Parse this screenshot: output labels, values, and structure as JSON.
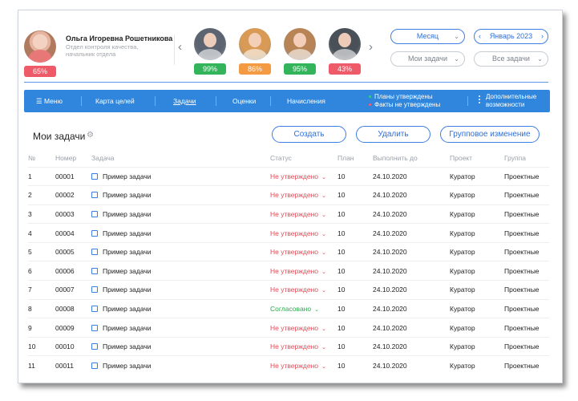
{
  "profile": {
    "name": "Ольга Игоревна Рошетникова",
    "role": "Отдел контроля качества, начальник отдела",
    "score": "65%",
    "score_color": "#ee5a67"
  },
  "colleagues": [
    {
      "score": "99%",
      "color": "#33b35a",
      "photo": "#5b6470"
    },
    {
      "score": "86%",
      "color": "#f39a43",
      "photo": "#d89a55"
    },
    {
      "score": "95%",
      "color": "#33b35a",
      "photo": "#b88456"
    },
    {
      "score": "43%",
      "color": "#ee5a67",
      "photo": "#4a5058"
    }
  ],
  "filters": {
    "period": "Месяц",
    "month": "Январь 2023",
    "my_tasks": "Мои задачи",
    "all_tasks": "Все задачи",
    "prev_icon": "chevron-left-icon",
    "next_icon": "chevron-right-icon"
  },
  "nav": {
    "menu": "Меню",
    "goals_map": "Карта целей",
    "tasks": "Задачи",
    "ratings": "Оценки",
    "accruals": "Начисления",
    "plans_approved": "Планы утверждены",
    "facts_not_approved": "Факты не утверждены",
    "additional_1": "Дополнительные",
    "additional_2": "возможности"
  },
  "tasks": {
    "title": "Мои задачи",
    "create": "Создать",
    "delete": "Удалить",
    "group_change": "Групповое изменение",
    "columns": [
      "№",
      "Номер",
      "Задача",
      "Статус",
      "План",
      "Выполнить до",
      "Проект",
      "Группа"
    ],
    "rows": [
      {
        "n": "1",
        "number": "00001",
        "task": "Пример задачи",
        "status": "Не утверждено",
        "ok": false,
        "plan": "10",
        "due": "24.10.2020",
        "project": "Куратор",
        "group": "Проектные"
      },
      {
        "n": "2",
        "number": "00002",
        "task": "Пример задачи",
        "status": "Не утверждено",
        "ok": false,
        "plan": "10",
        "due": "24.10.2020",
        "project": "Куратор",
        "group": "Проектные"
      },
      {
        "n": "3",
        "number": "00003",
        "task": "Пример задачи",
        "status": "Не утверждено",
        "ok": false,
        "plan": "10",
        "due": "24.10.2020",
        "project": "Куратор",
        "group": "Проектные"
      },
      {
        "n": "4",
        "number": "00004",
        "task": "Пример задачи",
        "status": "Не утверждено",
        "ok": false,
        "plan": "10",
        "due": "24.10.2020",
        "project": "Куратор",
        "group": "Проектные"
      },
      {
        "n": "5",
        "number": "00005",
        "task": "Пример задачи",
        "status": "Не утверждено",
        "ok": false,
        "plan": "10",
        "due": "24.10.2020",
        "project": "Куратор",
        "group": "Проектные"
      },
      {
        "n": "6",
        "number": "00006",
        "task": "Пример задачи",
        "status": "Не утверждено",
        "ok": false,
        "plan": "10",
        "due": "24.10.2020",
        "project": "Куратор",
        "group": "Проектные"
      },
      {
        "n": "7",
        "number": "00007",
        "task": "Пример задачи",
        "status": "Не утверждено",
        "ok": false,
        "plan": "10",
        "due": "24.10.2020",
        "project": "Куратор",
        "group": "Проектные"
      },
      {
        "n": "8",
        "number": "00008",
        "task": "Пример задачи",
        "status": "Согласовано",
        "ok": true,
        "plan": "10",
        "due": "24.10.2020",
        "project": "Куратор",
        "group": "Проектные"
      },
      {
        "n": "9",
        "number": "00009",
        "task": "Пример задачи",
        "status": "Не утверждено",
        "ok": false,
        "plan": "10",
        "due": "24.10.2020",
        "project": "Куратор",
        "group": "Проектные"
      },
      {
        "n": "10",
        "number": "00010",
        "task": "Пример задачи",
        "status": "Не утверждено",
        "ok": false,
        "plan": "10",
        "due": "24.10.2020",
        "project": "Куратор",
        "group": "Проектные"
      },
      {
        "n": "11",
        "number": "00011",
        "task": "Пример задачи",
        "status": "Не утверждено",
        "ok": false,
        "plan": "10",
        "due": "24.10.2020",
        "project": "Куратор",
        "group": "Проектные"
      }
    ]
  },
  "colors": {
    "accent": "#2f86dc",
    "status_bad": "#e64b56",
    "status_ok": "#2fa84f",
    "legend_green": "#33d17a",
    "legend_red": "#ff5c6c"
  }
}
